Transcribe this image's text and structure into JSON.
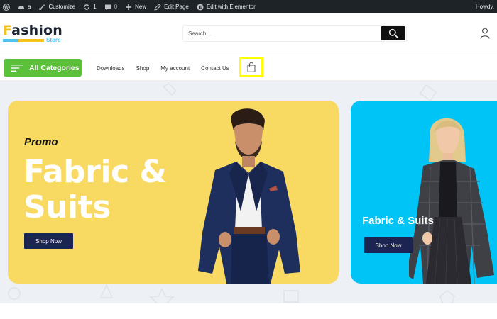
{
  "adminbar": {
    "site_name": "a",
    "customize": "Customize",
    "updates_count": "1",
    "comments_count": "0",
    "new_label": "New",
    "edit_page": "Edit Page",
    "elementor": "Edit with Elementor",
    "howdy": "Howdy,"
  },
  "header": {
    "logo_lead": "F",
    "logo_rest": "ashion",
    "logo_sub": "Store",
    "search_placeholder": "Search...",
    "icons": {
      "search": "search-icon",
      "user": "user-icon"
    }
  },
  "nav": {
    "all_categories": "All Categories",
    "links": [
      "Downloads",
      "Shop",
      "My account",
      "Contact Us"
    ],
    "cart_icon": "shopping-bag-icon"
  },
  "hero": {
    "card1": {
      "kicker": "Promo",
      "headline": "Fabric & Suits",
      "button": "Shop Now",
      "background": "#f8da63"
    },
    "card2": {
      "title": "Fabric & Suits",
      "button": "Shop Now",
      "background": "#00c4f5"
    }
  },
  "colors": {
    "accent_green": "#5bc13b",
    "dark_button": "#1c2452",
    "highlight": "#ffff00",
    "adminbar": "#1d2327"
  }
}
